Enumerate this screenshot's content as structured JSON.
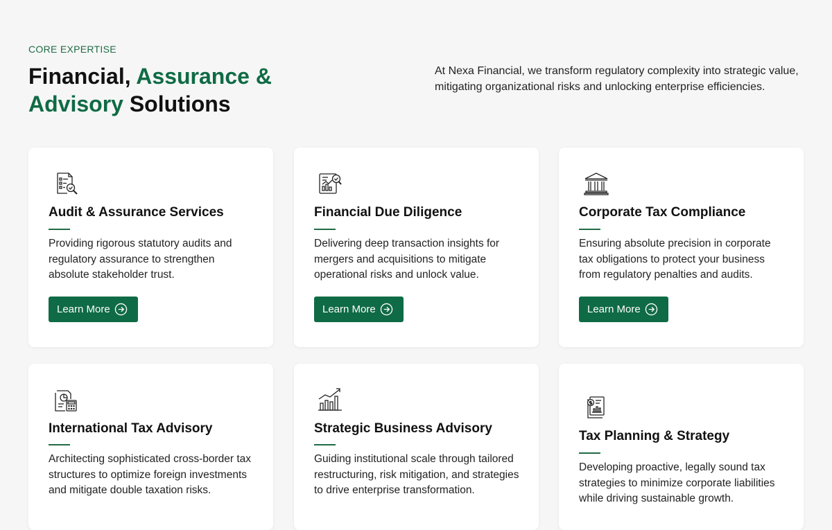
{
  "header": {
    "eyebrow": "CORE EXPERTISE",
    "title_part1": "Financial, ",
    "title_accent1": "Assurance &",
    "title_accent2": "Advisory",
    "title_part2": " Solutions",
    "intro": "At Nexa Financial, we transform regulatory complexity into strategic value, mitigating organizational risks and unlocking enterprise efficiencies."
  },
  "colors": {
    "accent": "#0f6b45",
    "background": "#f6f6f6",
    "card": "#ffffff"
  },
  "cards": [
    {
      "icon": "audit-document-icon",
      "title": "Audit & Assurance Services",
      "description": "Providing rigorous statutory audits and regulatory assurance to strengthen absolute stakeholder trust.",
      "button": "Learn More"
    },
    {
      "icon": "due-diligence-report-icon",
      "title": "Financial Due Diligence",
      "description": "Delivering deep transaction insights for mergers and acquisitions to mitigate operational risks and unlock value.",
      "button": "Learn More"
    },
    {
      "icon": "bank-building-icon",
      "title": "Corporate Tax Compliance",
      "description": "Ensuring absolute precision in corporate tax obligations to protect your business from regulatory penalties and audits.",
      "button": "Learn More"
    },
    {
      "icon": "tax-calculator-icon",
      "title": "International Tax Advisory",
      "description": "Architecting sophisticated cross-border tax structures to optimize foreign investments and mitigate double taxation risks."
    },
    {
      "icon": "growth-chart-icon",
      "title": "Strategic Business Advisory",
      "description": "Guiding institutional scale through tailored restructuring, risk mitigation, and strategies to drive enterprise transformation."
    },
    {
      "icon": "tax-report-icon",
      "title": "Tax Planning & Strategy",
      "description": "Developing proactive, legally sound tax strategies to minimize corporate liabilities while driving sustainable growth."
    }
  ]
}
